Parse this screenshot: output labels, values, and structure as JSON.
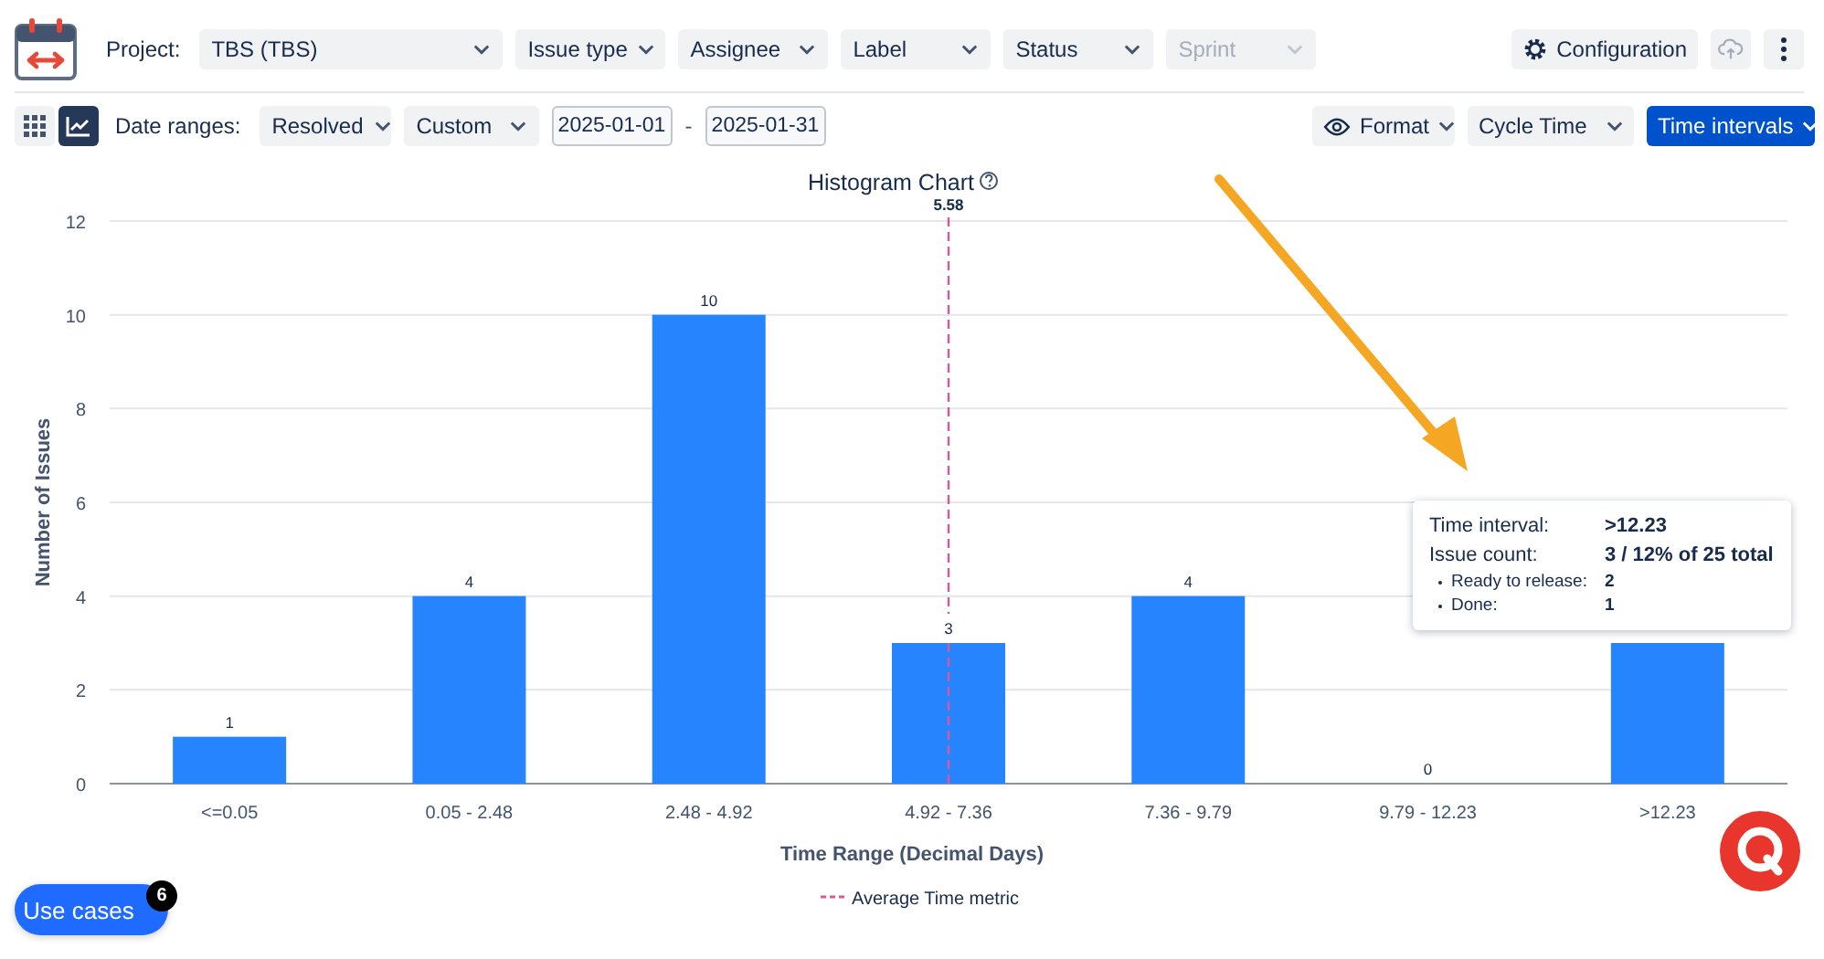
{
  "toolbar": {
    "project_label": "Project:",
    "filters": [
      {
        "label": "TBS (TBS)",
        "disabled": false,
        "wide": true
      },
      {
        "label": "Issue type",
        "disabled": false,
        "wide": false
      },
      {
        "label": "Assignee",
        "disabled": false,
        "wide": false
      },
      {
        "label": "Label",
        "disabled": false,
        "wide": false
      },
      {
        "label": "Status",
        "disabled": false,
        "wide": false
      },
      {
        "label": "Sprint",
        "disabled": true,
        "wide": false
      }
    ],
    "actions": [
      {
        "kind": "config",
        "label": "Configuration",
        "disabled": false
      },
      {
        "kind": "cloud",
        "disabled": true
      },
      {
        "kind": "more",
        "disabled": false
      }
    ]
  },
  "view_toggle": [
    {
      "kind": "grid",
      "selected": false
    },
    {
      "kind": "chart",
      "selected": true
    }
  ],
  "date_ranges": {
    "label": "Date ranges:",
    "type": "Resolved",
    "mode": "Custom",
    "from": "2025-01-01",
    "separator": "-",
    "to": "2025-01-31"
  },
  "right_controls": [
    {
      "kind": "format",
      "label": "Format",
      "primary": false
    },
    {
      "kind": "select",
      "label": "Cycle Time",
      "primary": false
    },
    {
      "kind": "split",
      "label": "Time intervals",
      "primary": true
    }
  ],
  "chart_data": {
    "type": "bar",
    "title": "Histogram Chart",
    "xlabel": "Time Range (Decimal Days)",
    "ylabel": "Number of Issues",
    "categories": [
      "<=0.05",
      "0.05 - 2.48",
      "2.48 - 4.92",
      "4.92 - 7.36",
      "7.36 - 9.79",
      "9.79 - 12.23",
      ">12.23"
    ],
    "values": [
      1,
      4,
      10,
      3,
      4,
      0,
      3
    ],
    "ylim": [
      0,
      12
    ],
    "yticks": [
      0,
      2,
      4,
      6,
      8,
      10,
      12
    ],
    "grid": true,
    "value_labels": [
      "1",
      "4",
      "10",
      "3",
      "4",
      "0",
      null
    ]
  },
  "average_marker": {
    "label": "5.58",
    "legend": "Average Time metric"
  },
  "tooltip": {
    "rows": [
      {
        "kind": "main",
        "label": "Time interval:",
        "value": ">12.23"
      },
      {
        "kind": "main",
        "label": "Issue count:",
        "value": "3 / 12% of 25 total"
      },
      {
        "kind": "sub",
        "label": "Ready to release:",
        "value": "2"
      },
      {
        "kind": "sub",
        "label": "Done:",
        "value": "1"
      }
    ]
  },
  "use_cases": {
    "label": "Use cases",
    "badge": "6"
  }
}
